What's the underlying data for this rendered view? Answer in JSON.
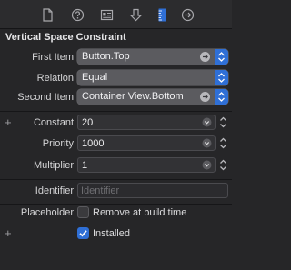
{
  "toolbar": {
    "tabs": [
      {
        "icon": "file-icon"
      },
      {
        "icon": "help-icon"
      },
      {
        "icon": "identity-icon"
      },
      {
        "icon": "attributes-icon"
      },
      {
        "icon": "size-ruler-icon",
        "selected": true
      },
      {
        "icon": "connections-arrow-icon"
      }
    ]
  },
  "section_title": "Vertical Space Constraint",
  "fields": {
    "first_item": {
      "label": "First Item",
      "value": "Button.Top"
    },
    "relation": {
      "label": "Relation",
      "value": "Equal"
    },
    "second_item": {
      "label": "Second Item",
      "value": "Container View.Bottom"
    },
    "constant": {
      "label": "Constant",
      "value": "20"
    },
    "priority": {
      "label": "Priority",
      "value": "1000"
    },
    "multiplier": {
      "label": "Multiplier",
      "value": "1"
    },
    "identifier": {
      "label": "Identifier",
      "value": "",
      "placeholder": "Identifier"
    },
    "placeholder": {
      "label": "Placeholder",
      "checkbox_label": "Remove at build time",
      "checked": false
    },
    "installed": {
      "checkbox_label": "Installed",
      "checked": true
    }
  },
  "plus_symbol": "+",
  "colors": {
    "accent": "#2f6fd6",
    "background": "#262628"
  }
}
